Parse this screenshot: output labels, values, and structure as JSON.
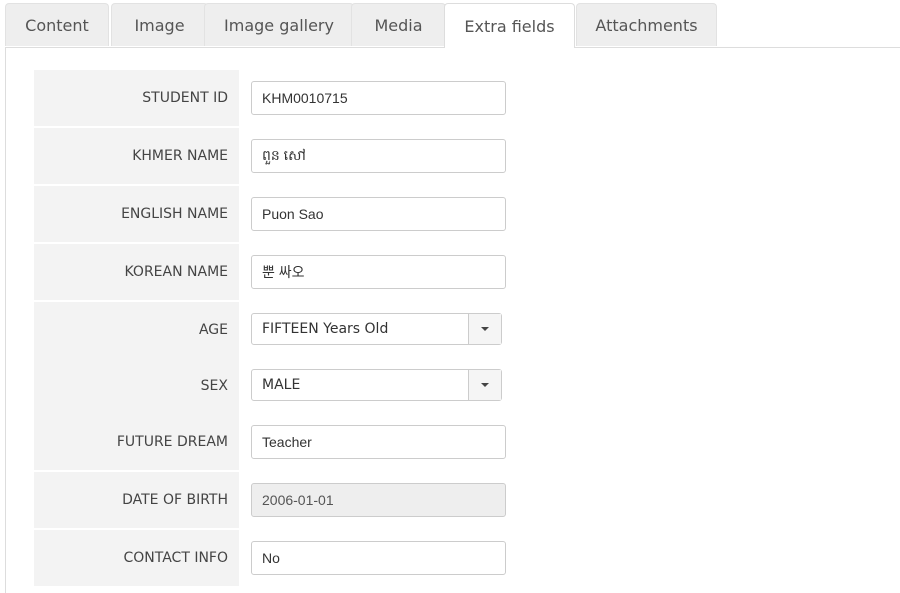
{
  "tabs": [
    {
      "label": "Content",
      "active": false
    },
    {
      "label": "Image",
      "active": false
    },
    {
      "label": "Image gallery",
      "active": false
    },
    {
      "label": "Media",
      "active": false
    },
    {
      "label": "Extra fields",
      "active": true
    },
    {
      "label": "Attachments",
      "active": false
    }
  ],
  "fields": {
    "student_id": {
      "label": "STUDENT ID",
      "value": "KHM0010715"
    },
    "khmer_name": {
      "label": "KHMER NAME",
      "value": "ពួន សៅ"
    },
    "english_name": {
      "label": "ENGLISH NAME",
      "value": "Puon Sao"
    },
    "korean_name": {
      "label": "KOREAN NAME",
      "value": "뿐 싸오"
    },
    "age": {
      "label": "AGE",
      "value": "FIFTEEN Years Old"
    },
    "sex": {
      "label": "SEX",
      "value": "MALE"
    },
    "future_dream": {
      "label": "FUTURE DREAM",
      "value": "Teacher"
    },
    "date_of_birth": {
      "label": "DATE OF BIRTH",
      "value": "2006-01-01"
    },
    "contact_info": {
      "label": "CONTACT INFO",
      "value": "No"
    }
  },
  "icons": {
    "dropdown": "chevron-down-icon"
  }
}
